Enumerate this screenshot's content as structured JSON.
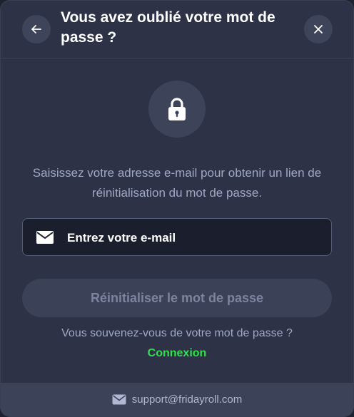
{
  "header": {
    "title": "Vous avez oublié votre mot de passe ?",
    "back_icon": "arrow-left-icon",
    "close_icon": "close-icon"
  },
  "main": {
    "lock_icon": "lock-icon",
    "description": "Saisissez votre adresse e-mail pour obtenir un lien de réinitialisation du mot de passe.",
    "email": {
      "icon": "mail-icon",
      "placeholder": "Entrez votre e-mail",
      "value": ""
    },
    "reset_label": "Réinitialiser le mot de passe",
    "remember_text": "Vous souvenez-vous de votre mot de passe ?",
    "login_label": "Connexion"
  },
  "footer": {
    "icon": "mail-icon",
    "support_email": "support@fridayroll.com"
  },
  "colors": {
    "background": "#2d3246",
    "accent_green": "#2ee04b",
    "text_muted": "#9fa8c5",
    "button_disabled": "#3b4156"
  }
}
